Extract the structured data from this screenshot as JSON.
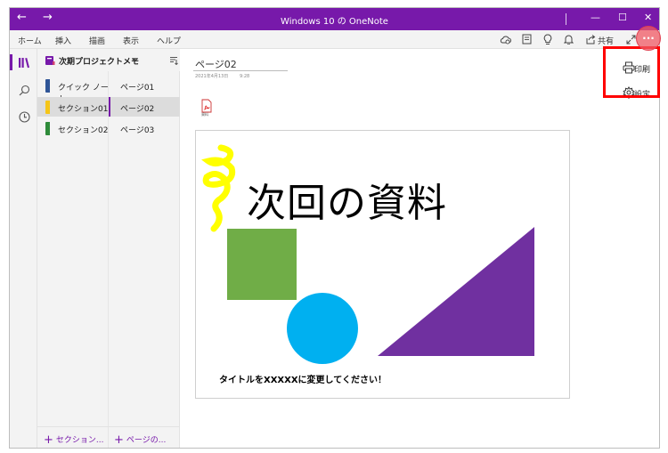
{
  "window": {
    "title": "Windows 10 の OneNote",
    "back": "←",
    "forward": "→",
    "minimize": "—",
    "maximize": "☐",
    "close": "✕"
  },
  "menu": {
    "tabs": [
      "ホーム",
      "挿入",
      "描画",
      "表示",
      "ヘルプ"
    ],
    "share_label": "共有",
    "more_label": "···"
  },
  "notebook": {
    "name": "次期プロジェクトメモ",
    "sections": [
      {
        "label": "クイック ノート",
        "color": "#2f5597",
        "active": false
      },
      {
        "label": "セクション01",
        "color": "#f5c518",
        "active": true
      },
      {
        "label": "セクション02",
        "color": "#2e8b3a",
        "active": false
      }
    ],
    "pages": [
      {
        "label": "ページ01",
        "active": false
      },
      {
        "label": "ページ02",
        "active": true
      },
      {
        "label": "ページ03",
        "active": false
      }
    ],
    "add_section": "セクション...",
    "add_page": "ページの..."
  },
  "page": {
    "title": "ページ02",
    "date": "2021年4月13日",
    "time": "9:28",
    "attachment_name": "資料",
    "slide_heading": "次回の資料",
    "slide_caption": "タイトルをXXXXXに変更してください！"
  },
  "more_menu": {
    "items": [
      {
        "label": "印刷",
        "icon": "printer-icon"
      },
      {
        "label": "設定",
        "icon": "gear-icon"
      }
    ]
  },
  "colors": {
    "accent": "#7719aa",
    "highlight": "#ff0000",
    "green_shape": "#70ad47",
    "blue_shape": "#00b0f0",
    "purple_shape": "#7030a0",
    "yellow_ink": "#ffff00"
  }
}
